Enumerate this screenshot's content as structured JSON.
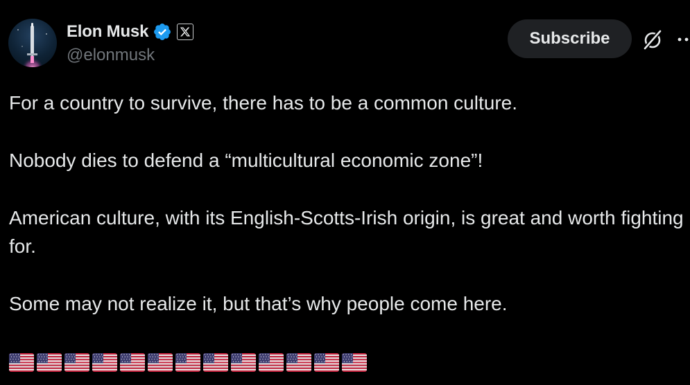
{
  "post": {
    "author": {
      "display_name": "Elon Musk",
      "handle": "@elonmusk",
      "avatar_icon": "rocket-launch-avatar",
      "verified_icon": "verified-badge-icon",
      "affiliation_icon": "x-logo-icon"
    },
    "actions": {
      "subscribe_label": "Subscribe",
      "grok_icon": "grok-slash-circle-icon",
      "more_icon": "more-dots-icon"
    },
    "paragraphs": [
      "For a country to survive, there has to be a common culture.",
      "Nobody dies to defend a “multicultural economic zone”!",
      "American culture, with its English-Scotts-Irish origin, is great and worth fighting for.",
      "Some may not realize it, but that’s why people come here."
    ],
    "emoji_line": {
      "emoji": "us-flag",
      "count": 13
    }
  },
  "colors": {
    "background": "#000000",
    "text_primary": "#e7e9ea",
    "text_secondary": "#71767b",
    "verified_blue": "#1d9bf0",
    "button_bg": "#1f2124"
  }
}
